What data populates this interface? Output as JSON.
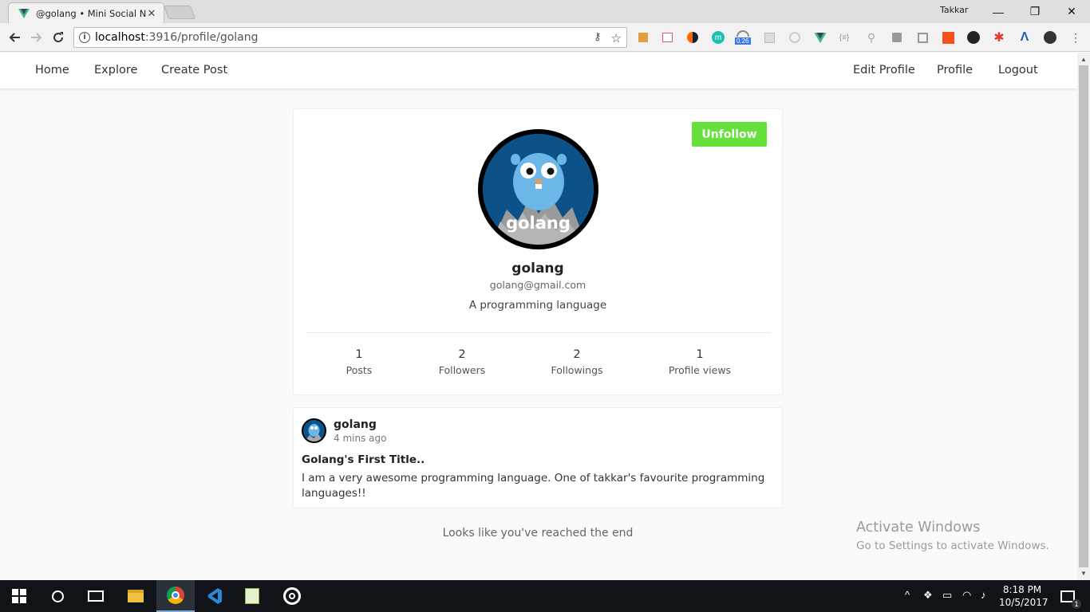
{
  "browser": {
    "tab_title": "@golang • Mini Social N",
    "profile_name": "Takkar",
    "url_host": "localhost",
    "url_path": ":3916/profile/golang",
    "extension_badge": "0.26",
    "extension_letter_m": "m",
    "extension_braces": "{≡}"
  },
  "nav": {
    "home": "Home",
    "explore": "Explore",
    "create_post": "Create Post",
    "edit_profile": "Edit Profile",
    "profile": "Profile",
    "logout": "Logout"
  },
  "profile": {
    "unfollow_label": "Unfollow",
    "avatar_text": "golang",
    "username": "golang",
    "email": "golang@gmail.com",
    "bio": "A programming language",
    "stats": [
      {
        "value": "1",
        "label": "Posts"
      },
      {
        "value": "2",
        "label": "Followers"
      },
      {
        "value": "2",
        "label": "Followings"
      },
      {
        "value": "1",
        "label": "Profile views"
      }
    ]
  },
  "post": {
    "username": "golang",
    "time": "4 mins ago",
    "title": "Golang's First Title..",
    "body": "I am a very awesome programming language. One of takkar's favourite programming languages!!"
  },
  "end_message": "Looks like you've reached the end",
  "watermark": {
    "line1": "Activate Windows",
    "line2": "Go to Settings to activate Windows."
  },
  "taskbar": {
    "time": "8:18 PM",
    "date": "10/5/2017",
    "notification_count": "1"
  },
  "colors": {
    "unfollow_bg": "#66e03a",
    "avatar_bg": "#0c5289"
  }
}
